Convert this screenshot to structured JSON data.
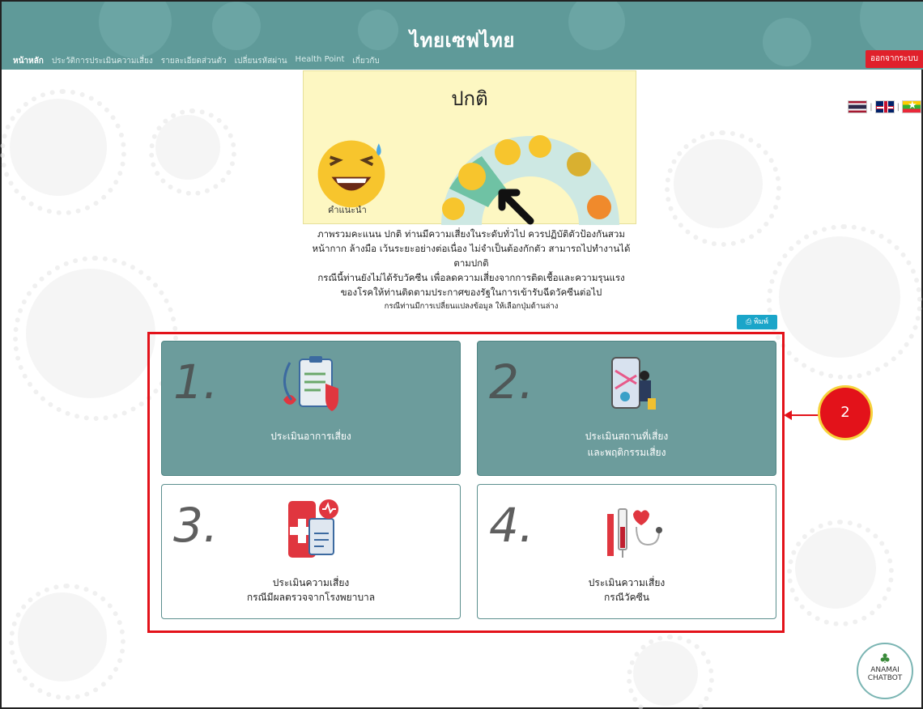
{
  "header": {
    "title": "ไทยเซฟไทย",
    "nav": [
      "หน้าหลัก",
      "ประวัติการประเมินความเสี่ยง",
      "รายละเอียดส่วนตัว",
      "เปลี่ยนรหัสผ่าน",
      "Health Point",
      "เกี่ยวกับ"
    ],
    "logout_label": "ออกจากระบบ"
  },
  "result": {
    "title": "ปกติ",
    "advice_label": "คำแนะนำ"
  },
  "summary": {
    "line1": "ภาพรวมคะแนน ปกติ ท่านมีความเสี่ยงในระดับทั่วไป ควรปฏิบัติตัวป้องกันสวม",
    "line2": "หน้ากาก ล้างมือ เว้นระยะอย่างต่อเนื่อง ไม่จำเป็นต้องกักตัว สามารถไปทำงานได้",
    "line3": "ตามปกติ",
    "line4": "กรณีนี้ท่านยังไม่ได้รับวัคซีน เพื่อลดความเสี่ยงจากการติดเชื้อและความรุนแรง",
    "line5": "ของโรคให้ท่านติดตามประกาศของรัฐในการเข้ารับฉีดวัคซีนต่อไป",
    "note": "กรณีท่านมีการเปลี่ยนแปลงข้อมูล ให้เลือกปุ่มด้านล่าง"
  },
  "print_label": "พิมพ์",
  "tiles": [
    {
      "num": "1.",
      "line1": "ประเมินอาการเสี่ยง",
      "line2": ""
    },
    {
      "num": "2.",
      "line1": "ประเมินสถานที่เสี่ยง",
      "line2": "และพฤติกรรมเสี่ยง"
    },
    {
      "num": "3.",
      "line1": "ประเมินความเสี่ยง",
      "line2": "กรณีมีผลตรวจจากโรงพยาบาล"
    },
    {
      "num": "4.",
      "line1": "ประเมินความเสี่ยง",
      "line2": "กรณีวัคซีน"
    }
  ],
  "callout_number": "2",
  "chatbot": {
    "line1": "ANAMAI",
    "line2": "CHATBOT"
  },
  "colors": {
    "header": "#5f9a99",
    "tile_dark": "#6c9c9c",
    "highlight": "#e3121a",
    "result_bg": "#fdf7c2"
  }
}
